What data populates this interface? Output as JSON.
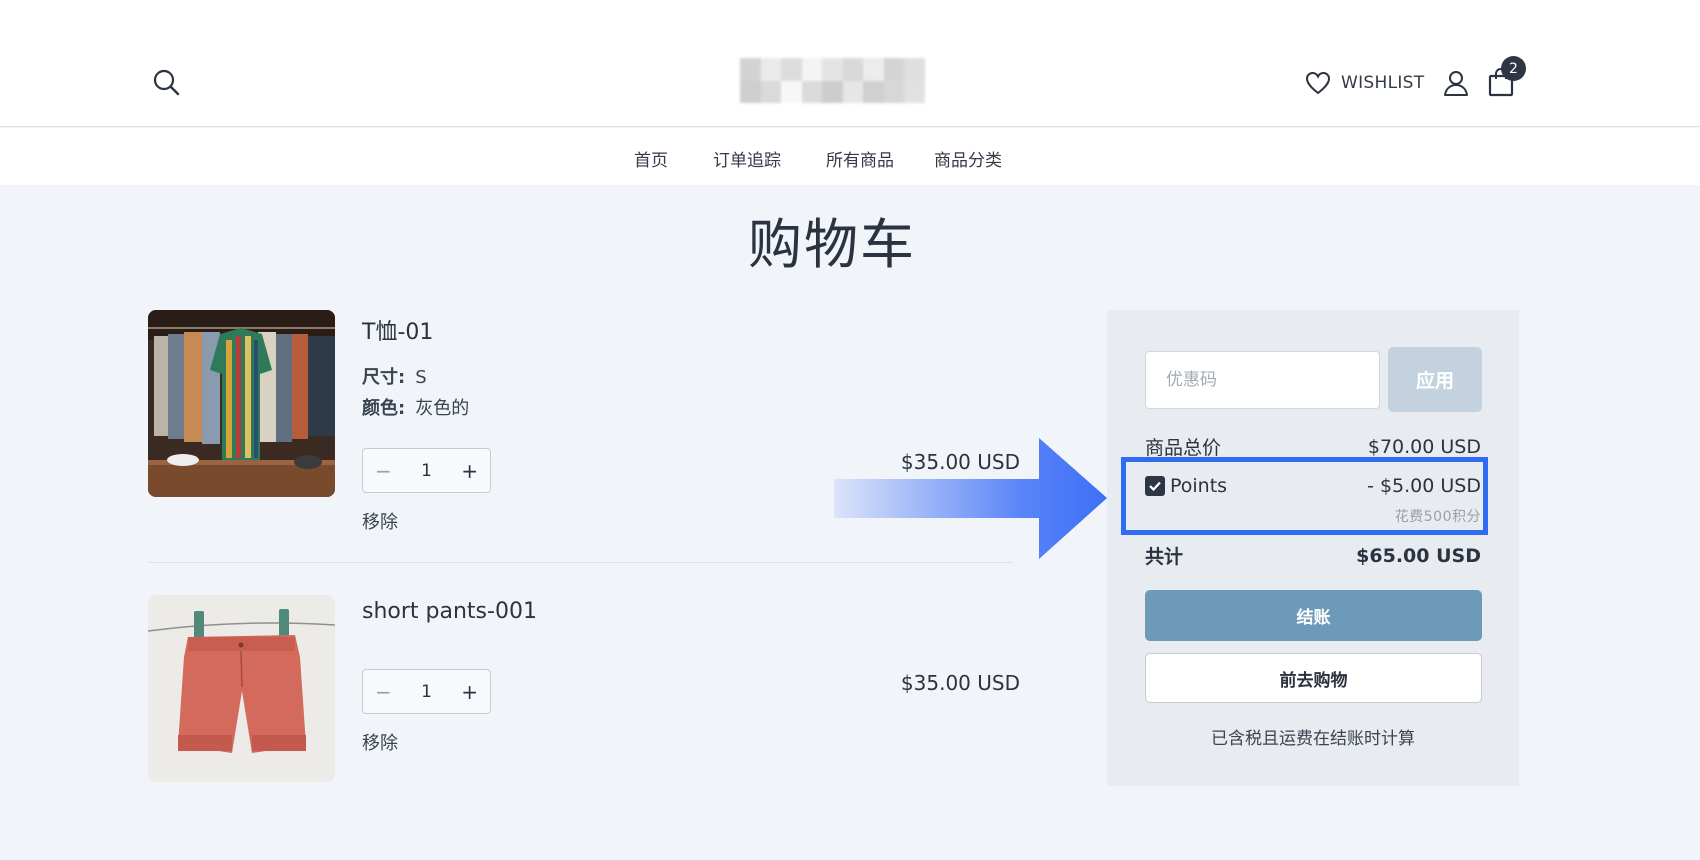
{
  "header": {
    "wishlist_label": "WISHLIST",
    "cart_count": "2"
  },
  "nav": {
    "items": [
      {
        "label": "首页"
      },
      {
        "label": "订单追踪"
      },
      {
        "label": "所有商品"
      },
      {
        "label": "商品分类"
      }
    ]
  },
  "page": {
    "title": "购物车"
  },
  "cart": {
    "items": [
      {
        "name": "T恤-01",
        "options": [
          {
            "label": "尺寸:",
            "value": "S"
          },
          {
            "label": "颜色:",
            "value": "灰色的"
          }
        ],
        "quantity": "1",
        "remove_label": "移除",
        "price": "$35.00 USD",
        "image": "shirt-rack-photo"
      },
      {
        "name": "short pants-001",
        "options": [],
        "quantity": "1",
        "remove_label": "移除",
        "price": "$35.00 USD",
        "image": "red-shorts-photo"
      }
    ]
  },
  "summary": {
    "coupon_placeholder": "优惠码",
    "apply_label": "应用",
    "subtotal_label": "商品总价",
    "subtotal_value": "$70.00 USD",
    "points_label": "Points",
    "points_value": "- $5.00 USD",
    "points_checked": true,
    "points_note": "花费500积分",
    "total_label": "共计",
    "total_value": "$65.00 USD",
    "checkout_label": "结账",
    "continue_label": "前去购物",
    "tax_note": "已含税且运费在结账时计算"
  },
  "colors": {
    "highlight": "#2f6cf2",
    "checkout": "#6c9ab8",
    "apply_disabled": "#c4d2df",
    "arrow": "#3d6ff8"
  }
}
